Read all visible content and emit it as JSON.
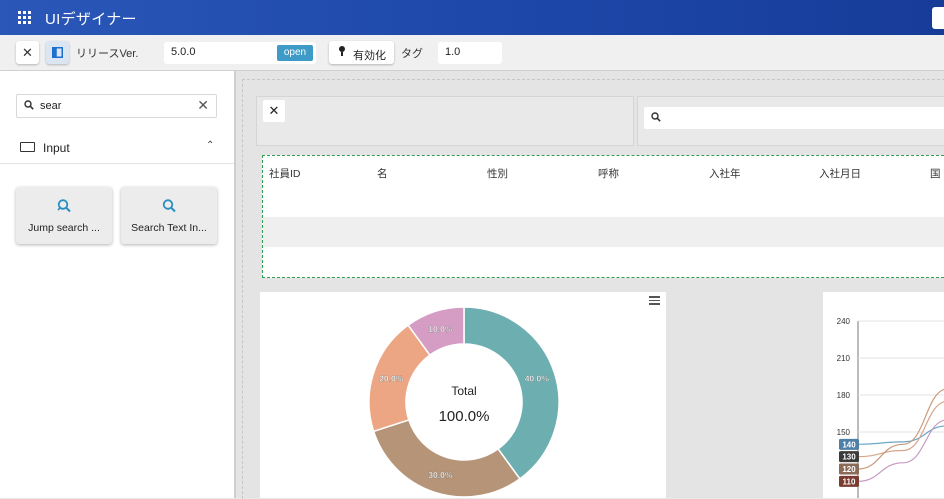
{
  "app": {
    "title": "UIデザイナー"
  },
  "toolbar": {
    "close_glyph": "✕",
    "release_label": "リリースVer.",
    "version_value": "5.0.0",
    "open_label": "open",
    "enable_label": "有効化",
    "tag_label": "タグ",
    "tag_value": "1.0"
  },
  "sidebar": {
    "search_value": "sear",
    "clear_glyph": "✕",
    "category": {
      "label": "Input",
      "chevron": "⌃"
    },
    "components": [
      {
        "label": "Jump search ...",
        "icon": "jump-search-icon"
      },
      {
        "label": "Search Text In...",
        "icon": "search-icon"
      }
    ]
  },
  "canvas": {
    "close_glyph": "✕",
    "table": {
      "columns": [
        "社員ID",
        "名",
        "性別",
        "呼称",
        "入社年",
        "入社月日",
        "国"
      ],
      "rows": [
        [],
        [],
        []
      ]
    },
    "colors": {
      "accent": "#3e9ac7",
      "selection": "#2e9e52",
      "header": "#1e49aa"
    }
  },
  "chart_data": [
    {
      "type": "pie",
      "title": "",
      "center_label": "Total",
      "center_value": "100.0%",
      "slices": [
        {
          "label": "40.0%",
          "value": 40,
          "color": "#6daeb0"
        },
        {
          "label": "30.0%",
          "value": 30,
          "color": "#b69478"
        },
        {
          "label": "20.0%",
          "value": 20,
          "color": "#eca683"
        },
        {
          "label": "10.0%",
          "value": 10,
          "color": "#d59dc4"
        }
      ]
    },
    {
      "type": "line",
      "title": "",
      "y_ticks": [
        "240",
        "210",
        "180",
        "150"
      ],
      "ylim": [
        100,
        240
      ],
      "start_labels": [
        {
          "text": "140",
          "value": 140,
          "color": "#4e7fa7"
        },
        {
          "text": "130",
          "value": 130,
          "color": "#3b3b3b"
        },
        {
          "text": "120",
          "value": 120,
          "color": "#8a6a58"
        },
        {
          "text": "110",
          "value": 110,
          "color": "#7a3b30"
        }
      ],
      "series": [
        {
          "values": [
            140,
            142,
            155
          ],
          "color": "#6aa8c8"
        },
        {
          "values": [
            130,
            135,
            175
          ],
          "color": "#d6a58a"
        },
        {
          "values": [
            120,
            140,
            185
          ],
          "color": "#c99b7d"
        },
        {
          "values": [
            110,
            125,
            160
          ],
          "color": "#c79bc0"
        }
      ]
    }
  ]
}
